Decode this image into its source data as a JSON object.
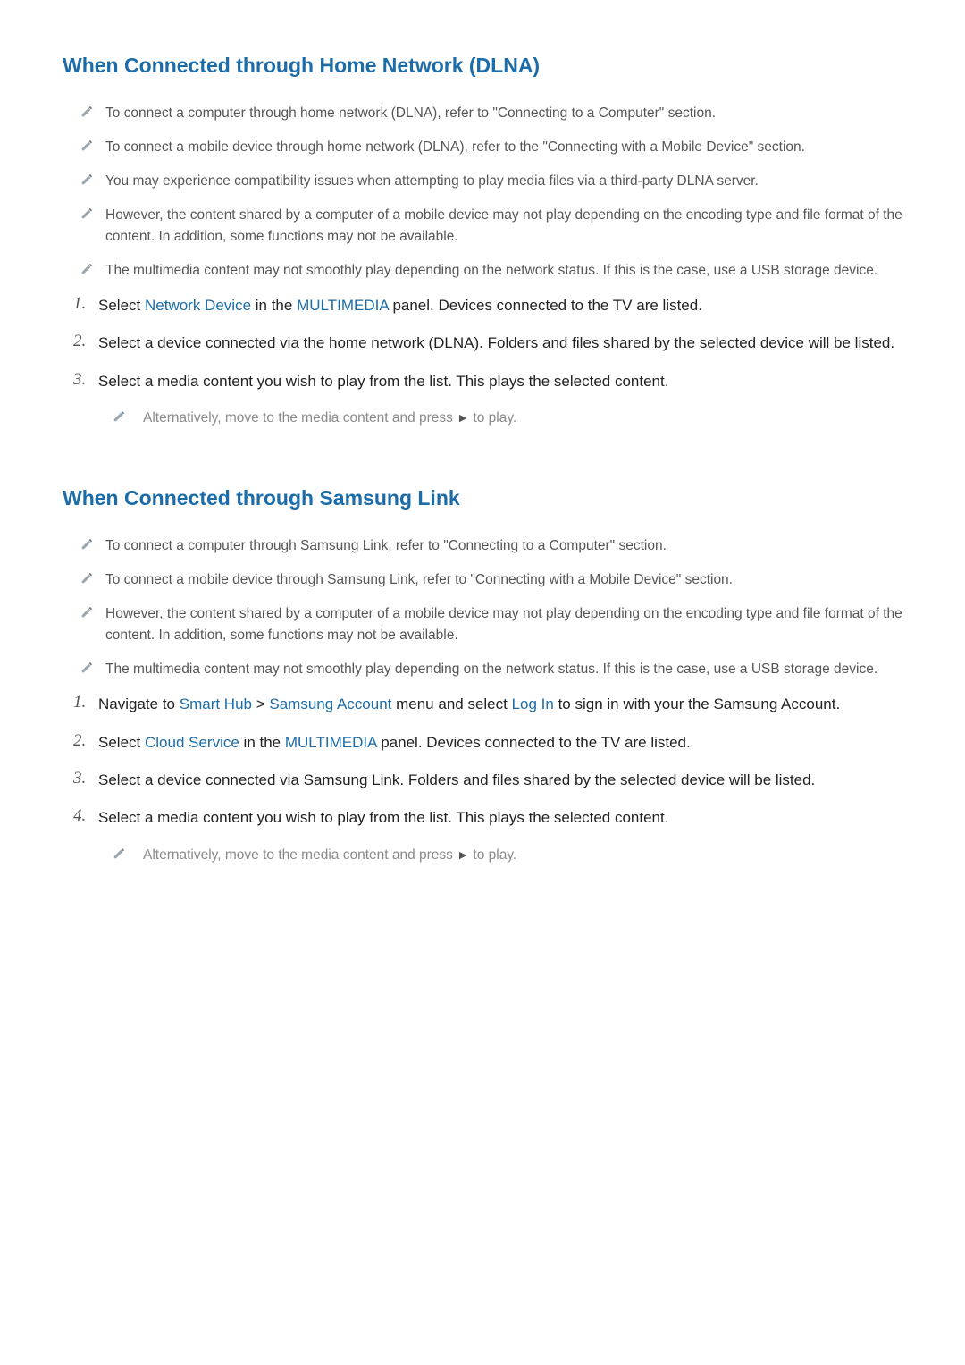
{
  "section1": {
    "heading": "When Connected through Home Network (DLNA)",
    "notes": [
      "To connect a computer through home network (DLNA), refer to \"Connecting to a Computer\" section.",
      "To connect a mobile device through home network (DLNA), refer to the \"Connecting with a Mobile Device\" section.",
      "You may experience compatibility issues when attempting to play media files via a third-party DLNA server.",
      "However, the content shared by a computer of a mobile device may not play depending on the encoding type and file format of the content. In addition, some functions may not be available.",
      "The multimedia content may not smoothly play depending on the network status. If this is the case, use a USB storage device."
    ],
    "steps": {
      "s1_pre": "Select ",
      "s1_link1": "Network Device",
      "s1_mid": " in the ",
      "s1_link2": "MULTIMEDIA",
      "s1_post": " panel. Devices connected to the TV are listed.",
      "s2": "Select a device connected via the home network (DLNA). Folders and files shared by the selected device will be listed.",
      "s3": "Select a media content you wish to play from the list. This plays the selected content."
    },
    "subnote_pre": "Alternatively, move to the media content and press ",
    "subnote_arrow": "►",
    "subnote_post": " to play."
  },
  "section2": {
    "heading": "When Connected through Samsung Link",
    "notes": [
      "To connect a computer through Samsung Link, refer to \"Connecting to a Computer\" section.",
      "To connect a mobile device through Samsung Link, refer to \"Connecting with a Mobile Device\" section.",
      "However, the content shared by a computer of a mobile device may not play depending on the encoding type and file format of the content. In addition, some functions may not be available.",
      "The multimedia content may not smoothly play depending on the network status. If this is the case, use a USB storage device."
    ],
    "steps": {
      "s1_pre": "Navigate to ",
      "s1_link1": "Smart Hub",
      "s1_sep": " > ",
      "s1_link2": "Samsung Account",
      "s1_mid": " menu and select ",
      "s1_link3": "Log In",
      "s1_post": " to sign in with your the Samsung Account.",
      "s2_pre": "Select ",
      "s2_link1": "Cloud Service",
      "s2_mid": " in the ",
      "s2_link2": "MULTIMEDIA",
      "s2_post": " panel. Devices connected to the TV are listed.",
      "s3": "Select a device connected via Samsung Link. Folders and files shared by the selected device will be listed.",
      "s4": "Select a media content you wish to play from the list. This plays the selected content."
    },
    "subnote_pre": "Alternatively, move to the media content and press ",
    "subnote_arrow": "►",
    "subnote_post": " to play."
  },
  "nums": {
    "n1": "1.",
    "n2": "2.",
    "n3": "3.",
    "n4": "4."
  }
}
